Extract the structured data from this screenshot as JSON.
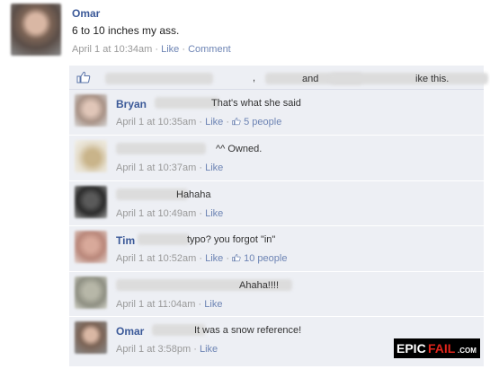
{
  "post": {
    "author": "Omar",
    "text": "6 to 10 inches my ass.",
    "timestamp": "April 1 at 10:34am",
    "like_label": "Like",
    "comment_label": "Comment",
    "separator": "·"
  },
  "likes": {
    "comma": ",",
    "and": "and",
    "suffix": "ike this."
  },
  "comments": [
    {
      "author": "Bryan",
      "text": "That's what she said",
      "timestamp": "April 1 at 10:35am",
      "like_label": "Like",
      "likes_count": "5 people"
    },
    {
      "author": "",
      "text": "^^ Owned.",
      "timestamp": "April 1 at 10:37am",
      "like_label": "Like"
    },
    {
      "author": "",
      "text": "Hahaha",
      "timestamp": "April 1 at 10:49am",
      "like_label": "Like"
    },
    {
      "author": "Tim",
      "text": "typo? you forgot \"in\"",
      "timestamp": "April 1 at 10:52am",
      "like_label": "Like",
      "likes_count": "10 people"
    },
    {
      "author": "",
      "text": "Ahaha!!!!",
      "timestamp": "April 1 at 11:04am",
      "like_label": "Like"
    },
    {
      "author": "Omar",
      "text": "It was a snow reference!",
      "timestamp": "April 1 at 3:58pm",
      "like_label": "Like"
    }
  ],
  "watermark": {
    "text": "EPICFAIL.COM"
  },
  "colors": {
    "link_blue": "#3b5998",
    "meta_gray": "#999999",
    "comment_bg": "#edeff4"
  },
  "icons": {
    "like": "thumbs-up-icon"
  }
}
